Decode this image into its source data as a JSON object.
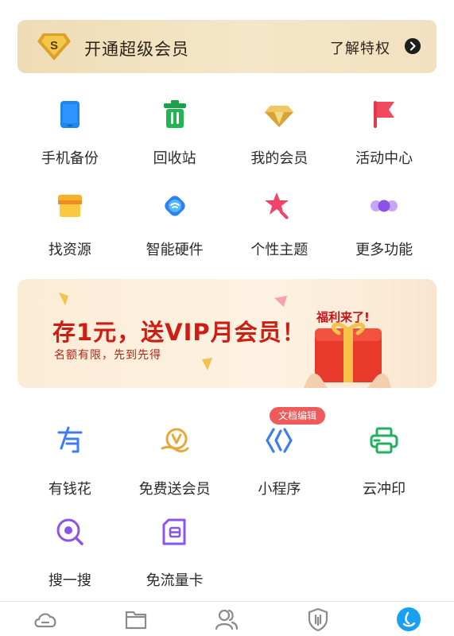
{
  "vip_bar": {
    "badge_letter": "S",
    "title": "开通超级会员",
    "more": "了解特权"
  },
  "tools": [
    {
      "label": "手机备份",
      "icon": "phone-backup-icon"
    },
    {
      "label": "回收站",
      "icon": "recycle-bin-icon"
    },
    {
      "label": "我的会员",
      "icon": "diamond-icon"
    },
    {
      "label": "活动中心",
      "icon": "flag-icon"
    },
    {
      "label": "找资源",
      "icon": "shop-icon"
    },
    {
      "label": "智能硬件",
      "icon": "smart-hardware-icon"
    },
    {
      "label": "个性主题",
      "icon": "star-wand-icon"
    },
    {
      "label": "更多功能",
      "icon": "more-dots-icon"
    }
  ],
  "banner": {
    "title": "存1元，送VIP月会员！",
    "subtitle": "名额有限，先到先得",
    "tag": "福利来了!"
  },
  "services": [
    {
      "label": "有钱花",
      "icon": "youqianhua-icon"
    },
    {
      "label": "免费送会员",
      "icon": "free-vip-icon"
    },
    {
      "label": "小程序",
      "icon": "mini-program-icon",
      "badge": "文档编辑"
    },
    {
      "label": "云冲印",
      "icon": "printer-icon"
    },
    {
      "label": "搜一搜",
      "icon": "search-icon"
    },
    {
      "label": "免流量卡",
      "icon": "data-card-icon"
    }
  ],
  "tabbar": [
    "cloud-home-icon",
    "folder-icon",
    "contacts-icon",
    "shield-icon",
    "profile-icon"
  ],
  "colors": {
    "active_tab": "#1aa0f0",
    "banner_red": "#cc1e14",
    "badge_red": "#f05a5a"
  }
}
